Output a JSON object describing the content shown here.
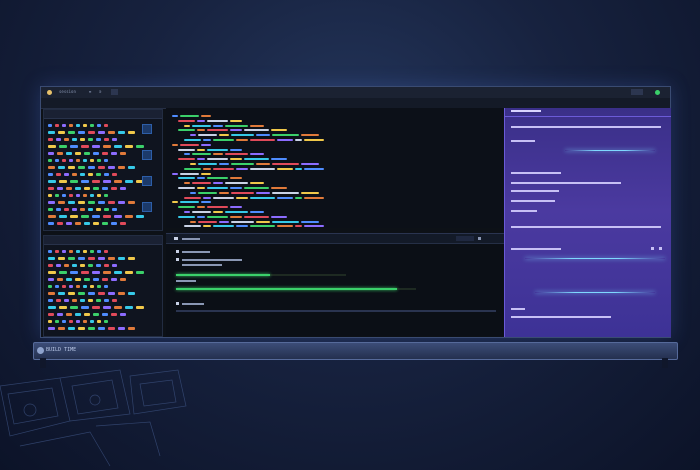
{
  "window": {
    "title_text": "session",
    "tab_labels": [
      "≡",
      "ə"
    ],
    "controls": [
      "—",
      "□",
      "×"
    ]
  },
  "dock": {
    "label": "BUILD TIME"
  },
  "colors": {
    "accent": "#4b3aa0",
    "success": "#3bd06a",
    "glow": "#7fd8ff",
    "background": "#17223f"
  },
  "progress": {
    "bar1": 0.55,
    "bar2": 0.92
  },
  "icons": [
    "app-icon",
    "close-icon",
    "maximize-icon",
    "minimize-icon",
    "terminal-icon",
    "search-icon"
  ]
}
